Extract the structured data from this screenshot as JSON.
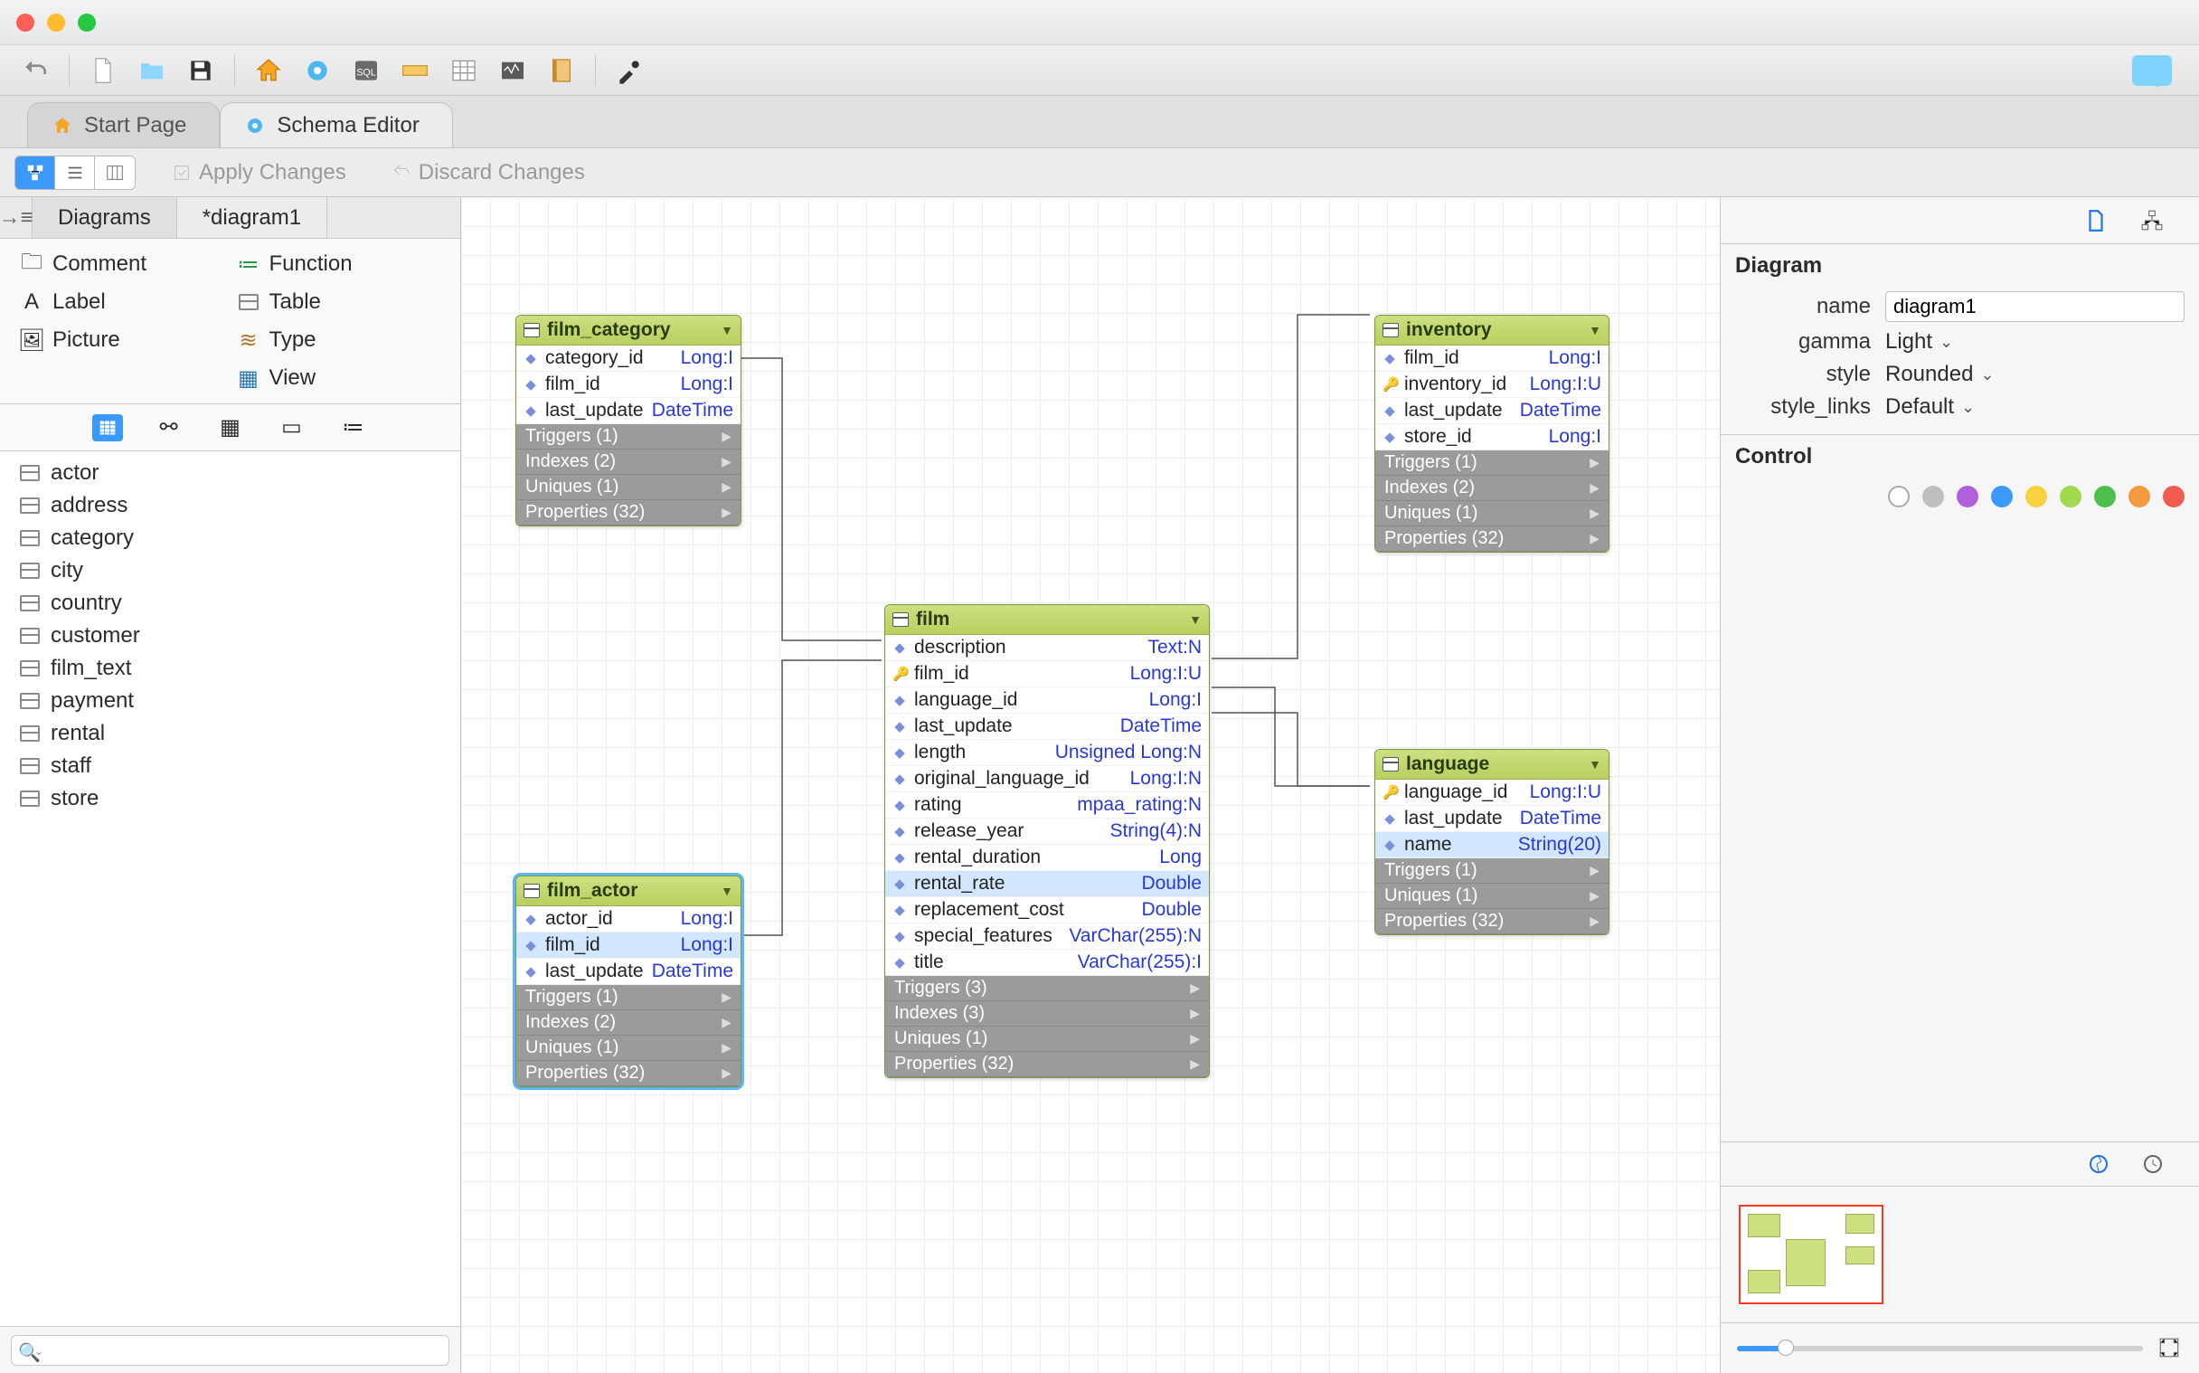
{
  "tabs": {
    "start": "Start Page",
    "schema": "Schema Editor"
  },
  "actions": {
    "apply": "Apply Changes",
    "discard": "Discard Changes"
  },
  "subtabs": {
    "diagrams": "Diagrams",
    "current": "*diagram1"
  },
  "palette": {
    "comment": "Comment",
    "function": "Function",
    "label": "Label",
    "table": "Table",
    "picture": "Picture",
    "type": "Type",
    "view": "View"
  },
  "tables": [
    "actor",
    "address",
    "category",
    "city",
    "country",
    "customer",
    "film_text",
    "payment",
    "rental",
    "staff",
    "store"
  ],
  "er": {
    "film_category": {
      "title": "film_category",
      "cols": [
        {
          "icon": "◆",
          "name": "category_id",
          "type": "Long:I"
        },
        {
          "icon": "◆",
          "name": "film_id",
          "type": "Long:I"
        },
        {
          "icon": "◆",
          "name": "last_update",
          "type": "DateTime"
        }
      ],
      "secs": [
        "Triggers (1)",
        "Indexes (2)",
        "Uniques (1)",
        "Properties (32)"
      ]
    },
    "film_actor": {
      "title": "film_actor",
      "cols": [
        {
          "icon": "◆",
          "name": "actor_id",
          "type": "Long:I"
        },
        {
          "icon": "◆",
          "name": "film_id",
          "type": "Long:I",
          "hl": true
        },
        {
          "icon": "◆",
          "name": "last_update",
          "type": "DateTime"
        }
      ],
      "secs": [
        "Triggers (1)",
        "Indexes (2)",
        "Uniques (1)",
        "Properties (32)"
      ]
    },
    "film": {
      "title": "film",
      "cols": [
        {
          "icon": "◆",
          "name": "description",
          "type": "Text:N"
        },
        {
          "icon": "🔑",
          "name": "film_id",
          "type": "Long:I:U"
        },
        {
          "icon": "◆",
          "name": "language_id",
          "type": "Long:I"
        },
        {
          "icon": "◆",
          "name": "last_update",
          "type": "DateTime"
        },
        {
          "icon": "◆",
          "name": "length",
          "type": "Unsigned Long:N"
        },
        {
          "icon": "◆",
          "name": "original_language_id",
          "type": "Long:I:N"
        },
        {
          "icon": "◆",
          "name": "rating",
          "type": "mpaa_rating:N"
        },
        {
          "icon": "◆",
          "name": "release_year",
          "type": "String(4):N"
        },
        {
          "icon": "◆",
          "name": "rental_duration",
          "type": "Long"
        },
        {
          "icon": "◆",
          "name": "rental_rate",
          "type": "Double",
          "hl": true
        },
        {
          "icon": "◆",
          "name": "replacement_cost",
          "type": "Double"
        },
        {
          "icon": "◆",
          "name": "special_features",
          "type": "VarChar(255):N"
        },
        {
          "icon": "◆",
          "name": "title",
          "type": "VarChar(255):I"
        }
      ],
      "secs": [
        "Triggers (3)",
        "Indexes (3)",
        "Uniques (1)",
        "Properties (32)"
      ]
    },
    "inventory": {
      "title": "inventory",
      "cols": [
        {
          "icon": "◆",
          "name": "film_id",
          "type": "Long:I"
        },
        {
          "icon": "🔑",
          "name": "inventory_id",
          "type": "Long:I:U"
        },
        {
          "icon": "◆",
          "name": "last_update",
          "type": "DateTime"
        },
        {
          "icon": "◆",
          "name": "store_id",
          "type": "Long:I"
        }
      ],
      "secs": [
        "Triggers (1)",
        "Indexes (2)",
        "Uniques (1)",
        "Properties (32)"
      ]
    },
    "language": {
      "title": "language",
      "cols": [
        {
          "icon": "🔑",
          "name": "language_id",
          "type": "Long:I:U"
        },
        {
          "icon": "◆",
          "name": "last_update",
          "type": "DateTime"
        },
        {
          "icon": "◆",
          "name": "name",
          "type": "String(20)",
          "hl": true
        }
      ],
      "secs": [
        "Triggers (1)",
        "Uniques (1)",
        "Properties (32)"
      ]
    }
  },
  "right": {
    "diagram_title": "Diagram",
    "name_label": "name",
    "name_value": "diagram1",
    "gamma_label": "gamma",
    "gamma_value": "Light",
    "style_label": "style",
    "style_value": "Rounded",
    "links_label": "style_links",
    "links_value": "Default",
    "control_title": "Control"
  }
}
